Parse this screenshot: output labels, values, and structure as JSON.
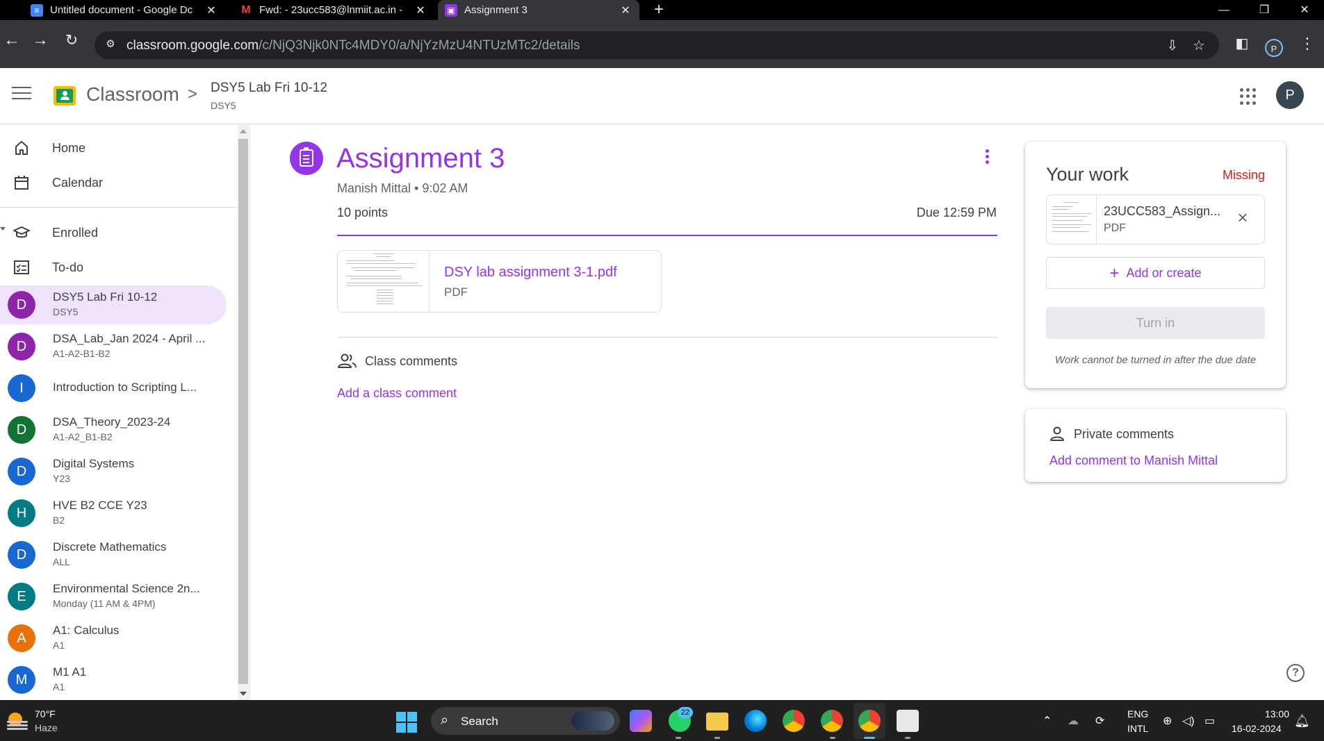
{
  "browser": {
    "tabs": [
      {
        "title": "Untitled document - Google Dc",
        "favicon": "docs-icon",
        "favicon_color": "#4285f4"
      },
      {
        "title": "Fwd: - 23ucc583@lnmiit.ac.in -",
        "favicon": "gmail-icon",
        "favicon_color": "#ea4335"
      },
      {
        "title": "Assignment 3",
        "favicon": "classroom-icon",
        "favicon_color": "#9334e6",
        "active": true
      }
    ],
    "new_tab": "+",
    "url_host": "classroom.google.com",
    "url_path": "/c/NjQ3Njk0NTc4MDY0/a/NjYzMzU4NTUzMTc2/details",
    "profile_initial": "P"
  },
  "header": {
    "app_name": "Classroom",
    "crumb_separator": ">",
    "class_title": "DSY5 Lab Fri 10-12",
    "class_section": "DSY5",
    "avatar_initial": "P"
  },
  "sidebar": {
    "nav": [
      {
        "label": "Home",
        "icon": "home-icon"
      },
      {
        "label": "Calendar",
        "icon": "calendar-icon"
      }
    ],
    "enrolled_label": "Enrolled",
    "todo_label": "To-do",
    "classes": [
      {
        "letter": "D",
        "color": "#8e24aa",
        "name": "DSY5 Lab Fri 10-12",
        "sub": "DSY5",
        "active": true
      },
      {
        "letter": "D",
        "color": "#8e24aa",
        "name": "DSA_Lab_Jan 2024 - April ...",
        "sub": "A1-A2-B1-B2"
      },
      {
        "letter": "I",
        "color": "#1967d2",
        "name": "Introduction to Scripting L...",
        "sub": ""
      },
      {
        "letter": "D",
        "color": "#137333",
        "name": "DSA_Theory_2023-24",
        "sub": "A1-A2_B1-B2"
      },
      {
        "letter": "D",
        "color": "#1967d2",
        "name": "Digital Systems",
        "sub": "Y23"
      },
      {
        "letter": "H",
        "color": "#007b83",
        "name": "HVE B2 CCE Y23",
        "sub": "B2"
      },
      {
        "letter": "D",
        "color": "#1967d2",
        "name": "Discrete Mathematics",
        "sub": "ALL"
      },
      {
        "letter": "E",
        "color": "#007b83",
        "name": "Environmental Science 2n...",
        "sub": "Monday (11 AM & 4PM)"
      },
      {
        "letter": "A",
        "color": "#e8710a",
        "name": "A1: Calculus",
        "sub": "A1"
      },
      {
        "letter": "M",
        "color": "#1967d2",
        "name": "M1 A1",
        "sub": "A1"
      }
    ]
  },
  "assignment": {
    "title": "Assignment 3",
    "author": "Manish Mittal",
    "meta_sep": " • ",
    "posted_time": "9:02 AM",
    "points": "10 points",
    "due": "Due 12:59 PM",
    "attachment_name": "DSY lab assignment 3-1.pdf",
    "attachment_type": "PDF",
    "class_comments_label": "Class comments",
    "add_class_comment": "Add a class comment",
    "accent_color": "#9334e6"
  },
  "your_work": {
    "title": "Your work",
    "status": "Missing",
    "status_color": "#c5221f",
    "file_name": "23UCC583_Assign...",
    "file_type": "PDF",
    "add_or_create": "Add or create",
    "turn_in": "Turn in",
    "note": "Work cannot be turned in after the due date"
  },
  "private_comments": {
    "label": "Private comments",
    "add_label": "Add comment to Manish Mittal"
  },
  "taskbar": {
    "temperature": "70°F",
    "condition": "Haze",
    "search_label": "Search",
    "whatsapp_badge": "22",
    "lang_line1": "ENG",
    "lang_line2": "INTL",
    "time": "13:00",
    "date": "16-02-2024"
  }
}
